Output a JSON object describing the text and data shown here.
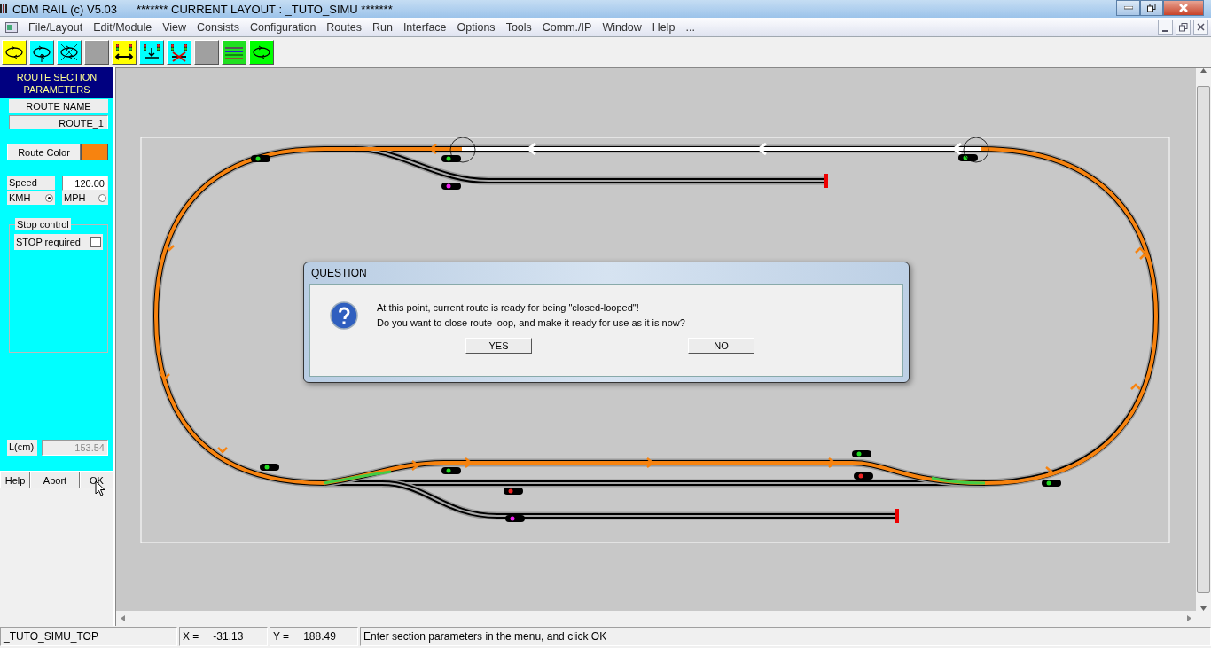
{
  "window": {
    "app_title": "CDM RAIL (c) V5.03",
    "layout_title": "******* CURRENT LAYOUT : _TUTO_SIMU *******"
  },
  "menu": [
    "File/Layout",
    "Edit/Module",
    "View",
    "Consists",
    "Configuration",
    "Routes",
    "Run",
    "Interface",
    "Options",
    "Tools",
    "Comm./IP",
    "Window",
    "Help",
    "..."
  ],
  "toolbar": [
    {
      "kind": "loop",
      "color": "#ffff00"
    },
    {
      "kind": "loop-arrow",
      "color": "#00ffff"
    },
    {
      "kind": "loop-cross",
      "color": "#00ffff"
    },
    {
      "kind": "blank",
      "color": "#a0a0a0"
    },
    {
      "kind": "signals-pair",
      "color": "#ffff00"
    },
    {
      "kind": "signals-down",
      "color": "#00ffff"
    },
    {
      "kind": "signals-cross",
      "color": "#00ffff"
    },
    {
      "kind": "blank",
      "color": "#a0a0a0"
    },
    {
      "kind": "lines",
      "color": "#20e020"
    },
    {
      "kind": "loop",
      "color": "#00ff00"
    }
  ],
  "panel": {
    "title": "ROUTE SECTION PARAMETERS",
    "route_name_label": "ROUTE NAME",
    "route_name": "ROUTE_1",
    "route_color": {
      "label": "Route Color",
      "color": "#f7830f"
    },
    "speed_label": "Speed",
    "speed_value": "120.00",
    "units": [
      {
        "label": "KMH",
        "selected": true
      },
      {
        "label": "MPH",
        "selected": false
      }
    ],
    "stop_group": "Stop control",
    "stop_required": {
      "label": "STOP required",
      "checked": false
    },
    "length_label": "L(cm)",
    "length_value": "153.54",
    "buttons": [
      "Help",
      "Abort",
      "OK"
    ]
  },
  "dialog": {
    "title": "QUESTION",
    "lines": [
      "At this point, current route is ready for being \"closed-looped\"!",
      "Do you want to close route loop, and make it ready for use as it is now?"
    ],
    "buttons": [
      "YES",
      "NO"
    ]
  },
  "status_bar": {
    "layout": "_TUTO_SIMU_TOP",
    "x_label": "X =",
    "x_value": "-31.13",
    "y_label": "Y =",
    "y_value": "188.49",
    "message": "Enter section parameters in the menu, and click OK"
  }
}
